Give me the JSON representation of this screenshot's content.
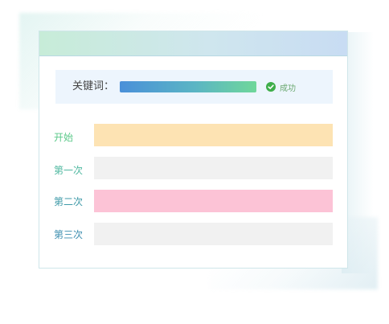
{
  "keyword": {
    "label": "关键词：",
    "progress_fraction": 1.0,
    "status_text": "成功",
    "status_icon": "check-circle-icon"
  },
  "rows": [
    {
      "label": "开始",
      "label_color": "#5cc98a",
      "box_color": "#fde3b3"
    },
    {
      "label": "第一次",
      "label_color": "#4fb8a0",
      "box_color": "#f1f1f1"
    },
    {
      "label": "第二次",
      "label_color": "#3f9aa8",
      "box_color": "#fcc3d6"
    },
    {
      "label": "第三次",
      "label_color": "#3e8fb0",
      "box_color": "#f1f1f1"
    }
  ],
  "colors": {
    "header_gradient": [
      "#c7ecd8",
      "#c8dcf3"
    ],
    "progress_gradient": [
      "#4a90d9",
      "#6fd79a"
    ],
    "success_green": "#3fae4a"
  }
}
